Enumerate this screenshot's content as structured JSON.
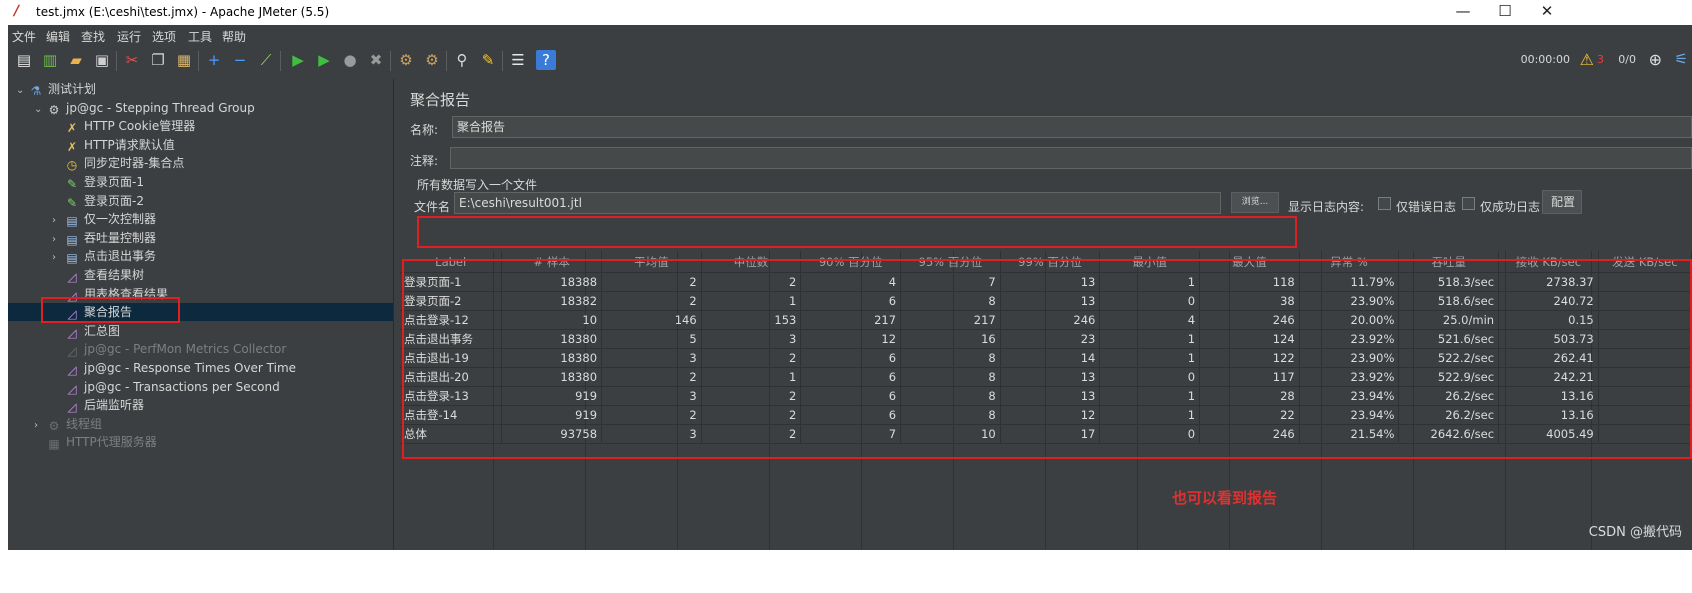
{
  "window": {
    "title": "test.jmx (E:\\ceshi\\test.jmx) - Apache JMeter (5.5)",
    "app_icon": "jmeter-feather-icon"
  },
  "menu": [
    "文件",
    "编辑",
    "查找",
    "运行",
    "选项",
    "工具",
    "帮助"
  ],
  "toolbar": {
    "icons": [
      "new-icon",
      "templates-icon",
      "open-icon",
      "save-icon",
      "cut-icon",
      "copy-icon",
      "paste-icon",
      "expand-icon",
      "collapse-icon",
      "toggle-icon",
      "start-icon",
      "start-no-pause-icon",
      "stop-icon",
      "shutdown-icon",
      "clear-icon",
      "clear-all-icon",
      "search-icon",
      "reset-search-icon",
      "function-helper-icon",
      "help-icon"
    ],
    "elapsed": "00:00:00",
    "warn_count": "3",
    "threads": "0/0"
  },
  "tree": [
    {
      "label": "测试计划",
      "icon": "flask-icon",
      "level": 0,
      "arrow": "⌄"
    },
    {
      "label": "jp@gc - Stepping Thread Group",
      "icon": "gear-icon",
      "level": 1,
      "arrow": "⌄"
    },
    {
      "label": "HTTP Cookie管理器",
      "icon": "wrench-icon",
      "level": 2,
      "arrow": ""
    },
    {
      "label": "HTTP请求默认值",
      "icon": "wrench-icon",
      "level": 2,
      "arrow": ""
    },
    {
      "label": "同步定时器-集合点",
      "icon": "timer-icon",
      "level": 2,
      "arrow": ""
    },
    {
      "label": "登录页面-1",
      "icon": "sampler-icon",
      "level": 2,
      "arrow": ""
    },
    {
      "label": "登录页面-2",
      "icon": "sampler-icon",
      "level": 2,
      "arrow": ""
    },
    {
      "label": "仅一次控制器",
      "icon": "controller-icon",
      "level": 2,
      "arrow": "›"
    },
    {
      "label": "吞吐量控制器",
      "icon": "controller-icon",
      "level": 2,
      "arrow": "›"
    },
    {
      "label": "点击退出事务",
      "icon": "controller-icon",
      "level": 2,
      "arrow": "›"
    },
    {
      "label": "查看结果树",
      "icon": "listener-icon",
      "level": 2,
      "arrow": ""
    },
    {
      "label": "用表格查看结果",
      "icon": "listener-icon",
      "level": 2,
      "arrow": ""
    },
    {
      "label": "聚合报告",
      "icon": "listener-icon",
      "level": 2,
      "arrow": "",
      "selected": true
    },
    {
      "label": "汇总图",
      "icon": "listener-icon",
      "level": 2,
      "arrow": ""
    },
    {
      "label": "jp@gc - PerfMon Metrics Collector",
      "icon": "listener-icon",
      "level": 2,
      "arrow": "",
      "disabled": true
    },
    {
      "label": "jp@gc - Response Times Over Time",
      "icon": "listener-icon",
      "level": 2,
      "arrow": ""
    },
    {
      "label": "jp@gc - Transactions per Second",
      "icon": "listener-icon",
      "level": 2,
      "arrow": ""
    },
    {
      "label": "后端监听器",
      "icon": "listener-icon",
      "level": 2,
      "arrow": ""
    },
    {
      "label": "线程组",
      "icon": "gear-icon",
      "level": 1,
      "arrow": "›",
      "disabled": true
    },
    {
      "label": "HTTP代理服务器",
      "icon": "proxy-icon",
      "level": 1,
      "arrow": "",
      "disabled": true
    }
  ],
  "panel": {
    "title": "聚合报告",
    "name_label": "名称:",
    "name_value": "聚合报告",
    "comment_label": "注释:",
    "comment_value": "",
    "group_title": "所有数据写入一个文件",
    "file_label": "文件名",
    "file_value": "E:\\ceshi\\result001.jtl",
    "browse_label": "浏览...",
    "log_display_label": "显示日志内容:",
    "errors_only_label": "仅错误日志",
    "success_only_label": "仅成功日志",
    "configure_label": "配置"
  },
  "table": {
    "headers": [
      "Label",
      "# 样本",
      "平均值",
      "中位数",
      "90% 百分位",
      "95% 百分位",
      "99% 百分位",
      "最小值",
      "最大值",
      "异常 %",
      "吞吐量",
      "接收 KB/sec",
      "发送 KB/sec"
    ],
    "rows": [
      [
        "登录页面-1",
        "18388",
        "2",
        "2",
        "4",
        "7",
        "13",
        "1",
        "118",
        "11.79%",
        "518.3/sec",
        "2738.37",
        ""
      ],
      [
        "登录页面-2",
        "18382",
        "2",
        "1",
        "6",
        "8",
        "13",
        "0",
        "38",
        "23.90%",
        "518.6/sec",
        "240.72",
        ""
      ],
      [
        "点击登录-12",
        "10",
        "146",
        "153",
        "217",
        "217",
        "246",
        "4",
        "246",
        "20.00%",
        "25.0/min",
        "0.15",
        ""
      ],
      [
        "点击退出事务",
        "18380",
        "5",
        "3",
        "12",
        "16",
        "23",
        "1",
        "124",
        "23.92%",
        "521.6/sec",
        "503.73",
        ""
      ],
      [
        "点击退出-19",
        "18380",
        "3",
        "2",
        "6",
        "8",
        "14",
        "1",
        "122",
        "23.90%",
        "522.2/sec",
        "262.41",
        ""
      ],
      [
        "点击退出-20",
        "18380",
        "2",
        "1",
        "6",
        "8",
        "13",
        "0",
        "117",
        "23.92%",
        "522.9/sec",
        "242.21",
        ""
      ],
      [
        "点击登录-13",
        "919",
        "3",
        "2",
        "6",
        "8",
        "13",
        "1",
        "28",
        "23.94%",
        "26.2/sec",
        "13.16",
        ""
      ],
      [
        "点击登-14",
        "919",
        "2",
        "2",
        "6",
        "8",
        "12",
        "1",
        "22",
        "23.94%",
        "26.2/sec",
        "13.16",
        ""
      ],
      [
        "总体",
        "93758",
        "3",
        "2",
        "7",
        "10",
        "17",
        "0",
        "246",
        "21.54%",
        "2642.6/sec",
        "4005.49",
        ""
      ]
    ]
  },
  "annotation": "也可以看到报告",
  "watermark": "CSDN @搬代码",
  "colors": {
    "highlight_red": "#e02020",
    "bg_dark": "#3c3f41",
    "selection": "#0d293e"
  }
}
